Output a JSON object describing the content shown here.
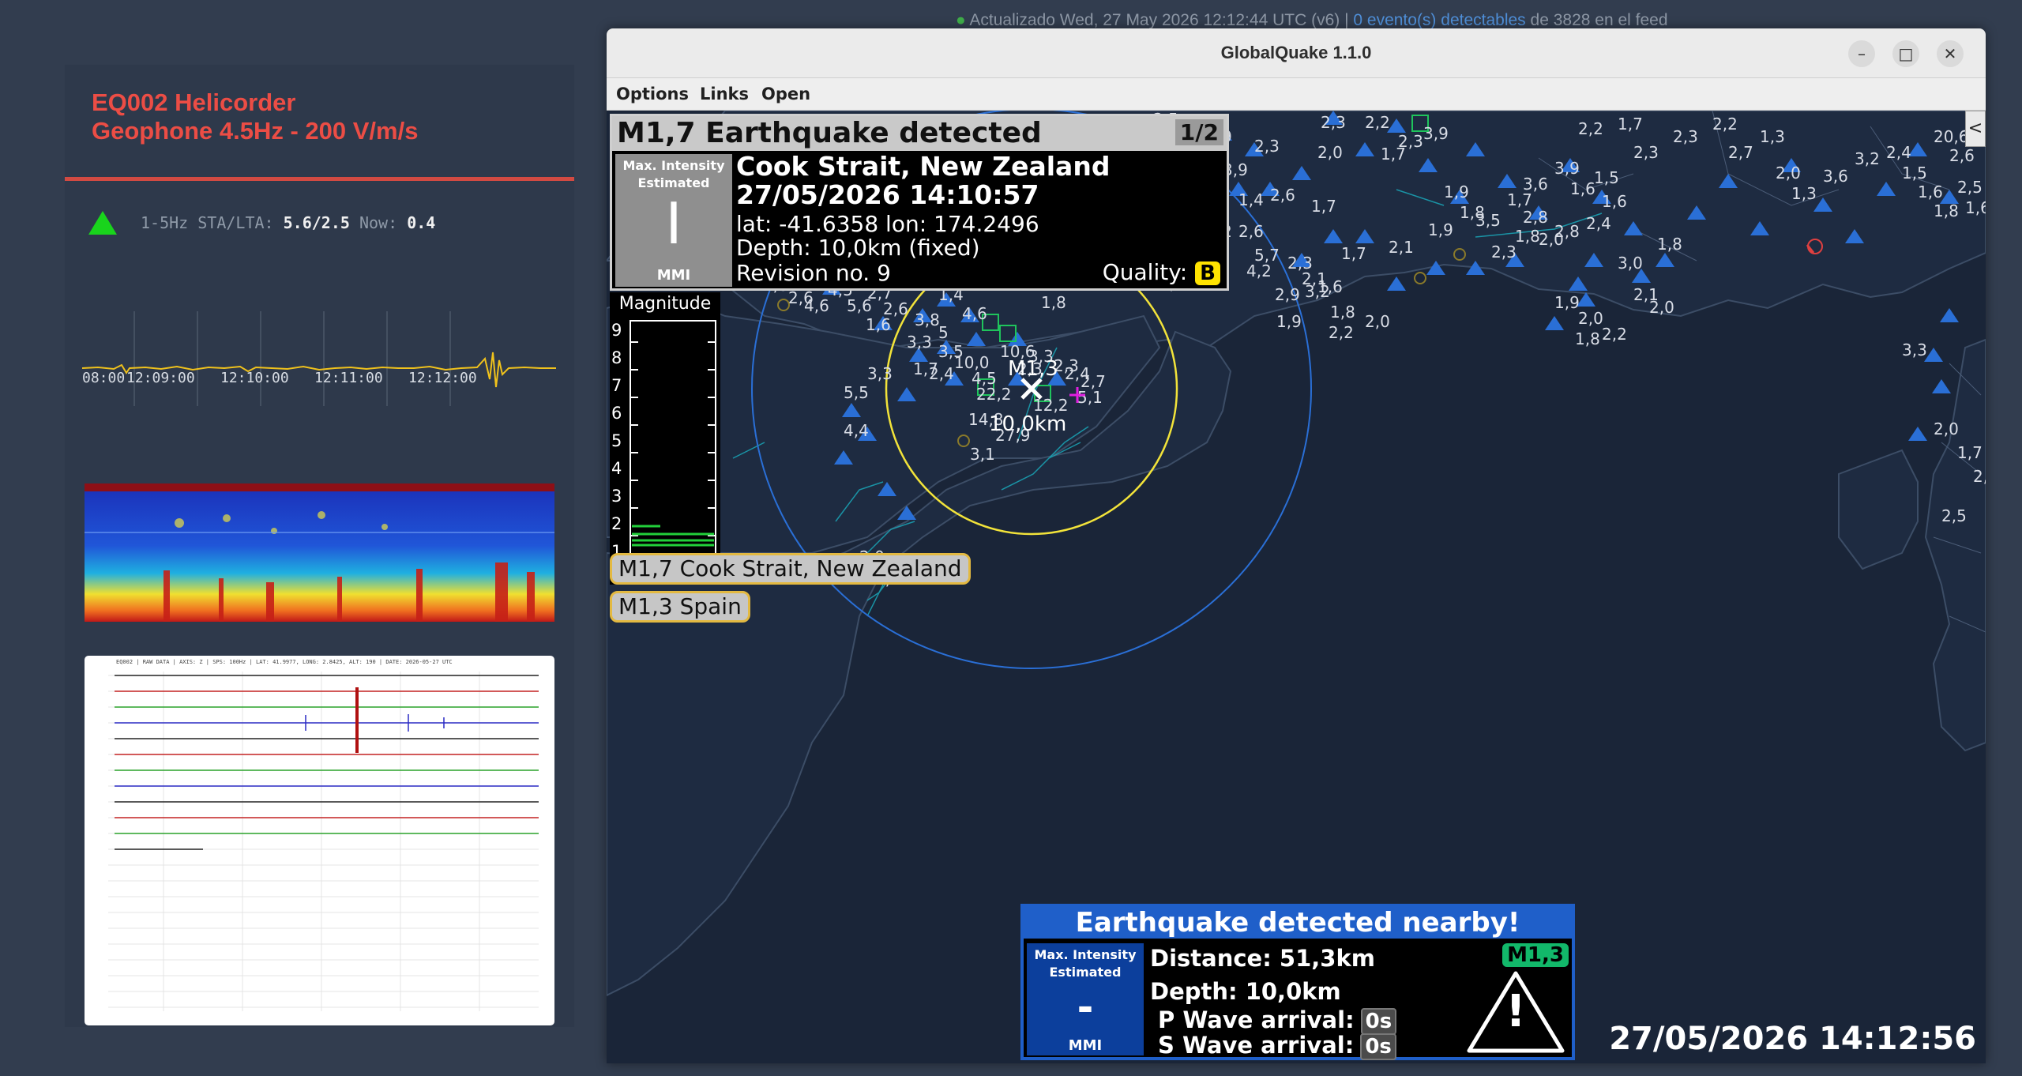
{
  "status_line": {
    "dot": "●",
    "updated": "Actualizado Wed, 27 May 2026 12:12:44 UTC (v6) |",
    "events_link": "0 evento(s) detectables",
    "feed_suffix": "de 3828 en el feed"
  },
  "helicorder": {
    "title_line1": "EQ002 Helicorder",
    "title_line2": "Geophone 4.5Hz - 200 V/m/s",
    "trigger_label": "1-5Hz STA/LTA:",
    "trigger_value": "5.6/2.5",
    "now_label": "Now:",
    "now_value": "0.4",
    "trigger_color": "#19d41c",
    "times": [
      "08:00",
      "12:09:00",
      "12:10:00",
      "12:11:00",
      "12:12:00"
    ]
  },
  "drum_plot": {
    "header": "EQ002 | RAW DATA | AXIS: Z | SPS: 100Hz | LAT: 41.9977, LONG: 2.8425, ALT: 190 | DATE: 2026-05-27 UTC"
  },
  "window": {
    "title": "GlobalQuake 1.1.0",
    "controls": [
      "–",
      "□",
      "✕"
    ],
    "menu": [
      "Options",
      "Links",
      "Open"
    ]
  },
  "detected_event": {
    "header": "M1,7 Earthquake detected",
    "count": "1/2",
    "mmi_label_top": "Max. Intensity Estimated",
    "mmi_value": "I",
    "mmi_label_bottom": "MMI",
    "region": "Cook Strait, New Zealand",
    "datetime": "27/05/2026 14:10:57",
    "coords": "lat: -41.6358 lon: 174.2496",
    "depth": "Depth: 10,0km (fixed)",
    "revision": "Revision no. 9",
    "quality_label": "Quality:",
    "quality_value": "B"
  },
  "magnitude_panel": {
    "title": "Magnitude",
    "scale": [
      "9",
      "8",
      "7",
      "6",
      "5",
      "4",
      "3",
      "2",
      "1"
    ]
  },
  "event_list": [
    "M1,7 Cook Strait, New Zealand",
    "M1,3 Spain"
  ],
  "map_markers": {
    "epicenter_mag": "M1,3",
    "epicenter_depth": "10,0km"
  },
  "nearby_alert": {
    "header": "Earthquake detected nearby!",
    "mmi_label_top": "Max. Intensity Estimated",
    "mmi_value": "-",
    "mmi_label_bottom": "MMI",
    "distance": "Distance: 51,3km",
    "depth": "Depth: 10,0km",
    "p_wave_label": "P Wave arrival:",
    "p_wave_value": "0s",
    "s_wave_label": "S Wave arrival:",
    "s_wave_value": "0s",
    "magnitude": "M1,3",
    "warning_icon": "!"
  },
  "clock": "27/05/2026 14:12:56",
  "collapse_button": "<",
  "colors": {
    "accent_red": "#ec4d45",
    "map_bg": "#1a2538",
    "station_blue": "#2a6fd6",
    "yellow_circle": "#f2e33a",
    "nearby_blue": "#1f5fc9"
  }
}
